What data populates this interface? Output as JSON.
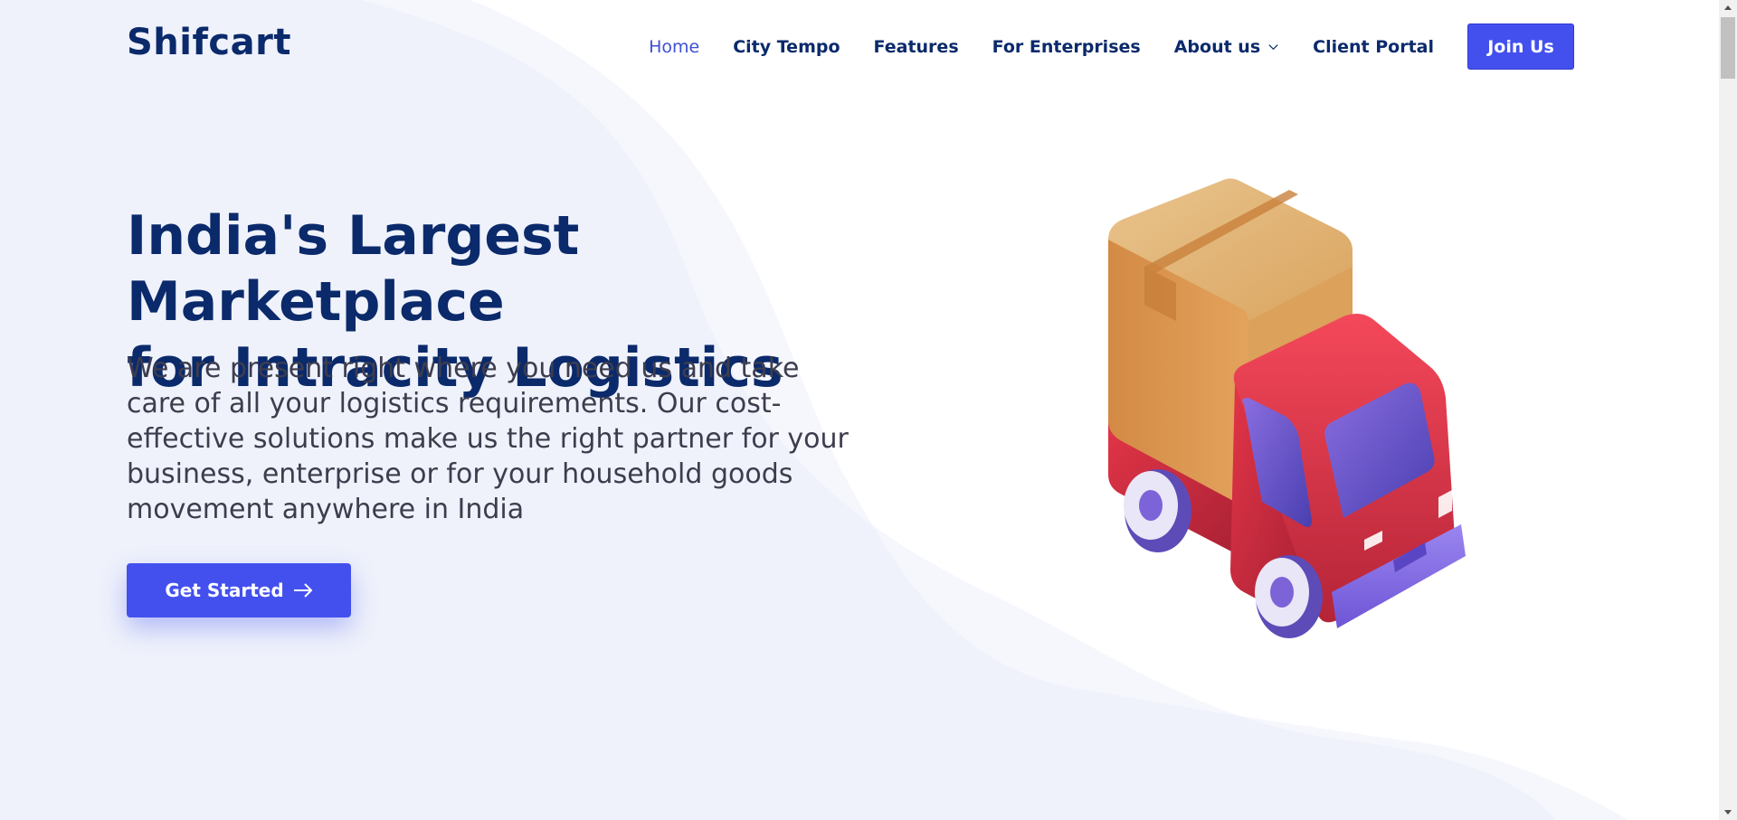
{
  "header": {
    "brand": "Shifcart",
    "nav": [
      {
        "label": "Home",
        "active": true
      },
      {
        "label": "City Tempo",
        "active": false
      },
      {
        "label": "Features",
        "active": false
      },
      {
        "label": "For Enterprises",
        "active": false
      },
      {
        "label": "About us",
        "active": false,
        "has_dropdown": true
      },
      {
        "label": "Client Portal",
        "active": false
      }
    ],
    "join_label": "Join Us"
  },
  "hero": {
    "title_line1": "India's Largest Marketplace",
    "title_line2": "for Intracity Logistics",
    "description": "We are present right where you need us and take care of all your logistics requirements. Our cost-effective solutions make us the right partner for your business, enterprise or for your household goods movement anywhere in India",
    "cta_label": "Get Started",
    "illustration": "delivery-truck-with-box-illustration"
  },
  "colors": {
    "brand_navy": "#0b2a6b",
    "accent_blue": "#4350ee",
    "active_nav": "#3f4fd4",
    "body_text": "#3d3d4e",
    "background_wave": "#eef1fb"
  }
}
